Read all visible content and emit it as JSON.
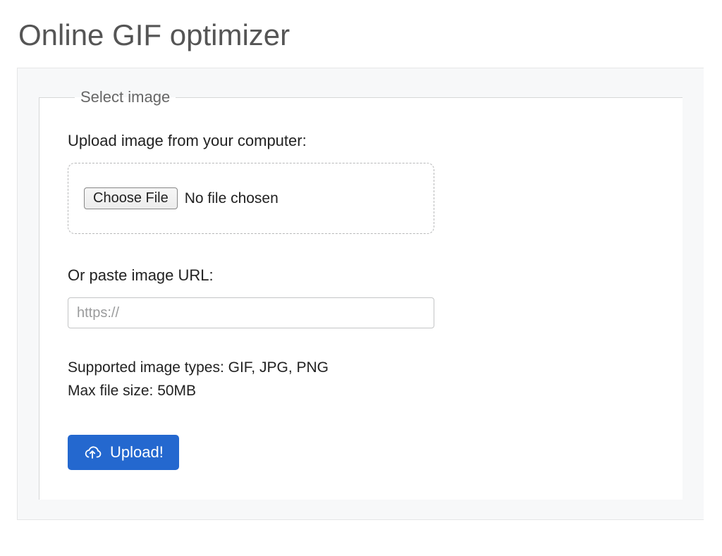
{
  "page": {
    "title": "Online GIF optimizer"
  },
  "form": {
    "legend": "Select image",
    "upload_label": "Upload image from your computer:",
    "choose_file_button": "Choose File",
    "file_status": "No file chosen",
    "url_label": "Or paste image URL:",
    "url_placeholder": "https://",
    "url_value": "",
    "supported_types": "Supported image types: GIF, JPG, PNG",
    "max_size": "Max file size: 50MB",
    "upload_button": "Upload!"
  }
}
